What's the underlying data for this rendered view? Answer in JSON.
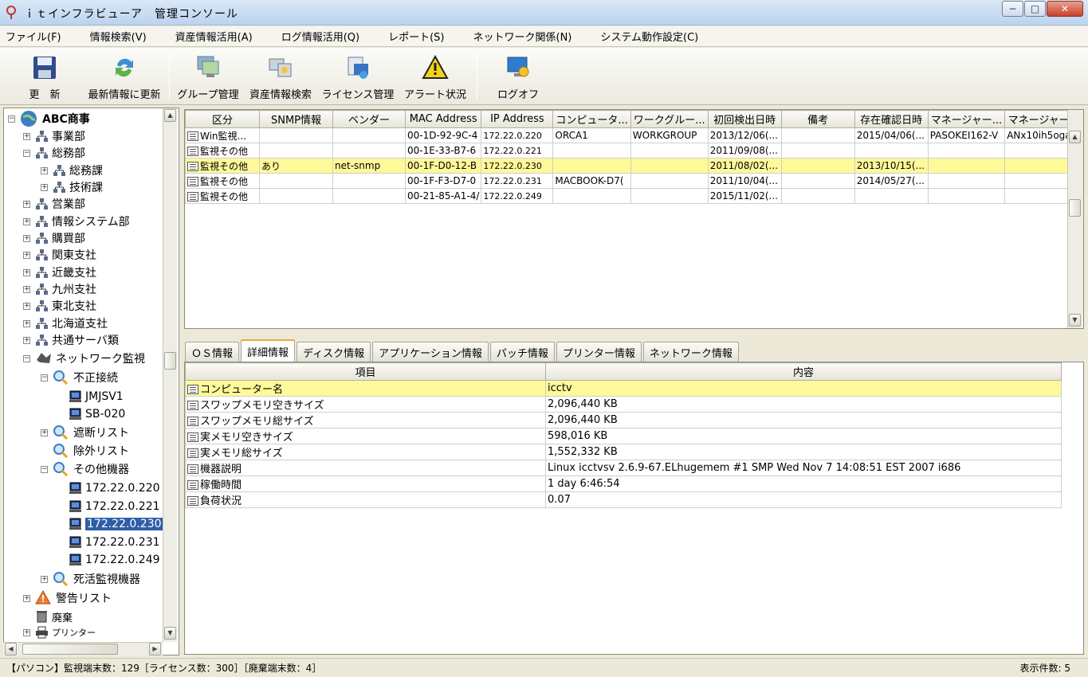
{
  "window": {
    "title": "ｉｔインフラビューア　管理コンソール",
    "min": "−",
    "max": "□",
    "close": "✕"
  },
  "menu": [
    "ファイル(F)",
    "情報検索(V)",
    "資産情報活用(A)",
    "ログ情報活用(Q)",
    "レポート(S)",
    "ネットワーク関係(N)",
    "システム動作設定(C)"
  ],
  "toolbar": {
    "update": "更　新",
    "refresh": "最新情報に更新",
    "group": "グループ管理",
    "asset_search": "資産情報検索",
    "license": "ライセンス管理",
    "alert": "アラート状況",
    "logoff": "ログオフ"
  },
  "tree": [
    {
      "label": "ABC商事",
      "exp": "−",
      "icon": "globe-icon",
      "bold": true
    },
    {
      "label": "事業部",
      "exp": "+",
      "icon": "org-icon"
    },
    {
      "label": "総務部",
      "exp": "−",
      "icon": "org-icon"
    },
    {
      "label": "総務課",
      "exp": "+",
      "icon": "org-icon"
    },
    {
      "label": "技術課",
      "exp": "+",
      "icon": "org-icon"
    },
    {
      "label": "営業部",
      "exp": "+",
      "icon": "org-icon"
    },
    {
      "label": "情報システム部",
      "exp": "+",
      "icon": "org-icon"
    },
    {
      "label": "購買部",
      "exp": "+",
      "icon": "org-icon"
    },
    {
      "label": "関東支社",
      "exp": "+",
      "icon": "org-icon"
    },
    {
      "label": "近畿支社",
      "exp": "+",
      "icon": "org-icon"
    },
    {
      "label": "九州支社",
      "exp": "+",
      "icon": "org-icon"
    },
    {
      "label": "東北支社",
      "exp": "+",
      "icon": "org-icon"
    },
    {
      "label": "北海道支社",
      "exp": "+",
      "icon": "org-icon"
    },
    {
      "label": "共通サーバ類",
      "exp": "+",
      "icon": "org-icon"
    },
    {
      "label": "ネットワーク監視",
      "exp": "−",
      "icon": "network-icon"
    },
    {
      "label": "不正接続",
      "exp": "−",
      "icon": "magnifier-icon"
    },
    {
      "label": "JMJSV1",
      "exp": "",
      "icon": "computer-icon"
    },
    {
      "label": "SB-020",
      "exp": "",
      "icon": "computer-icon"
    },
    {
      "label": "遮断リスト",
      "exp": "+",
      "icon": "magnifier-icon"
    },
    {
      "label": "除外リスト",
      "exp": "",
      "icon": "magnifier-icon"
    },
    {
      "label": "その他機器",
      "exp": "−",
      "icon": "magnifier-icon"
    },
    {
      "label": "172.22.0.220",
      "exp": "",
      "icon": "computer-icon"
    },
    {
      "label": "172.22.0.221",
      "exp": "",
      "icon": "computer-icon"
    },
    {
      "label": "172.22.0.230",
      "exp": "",
      "icon": "computer-icon",
      "selected": true
    },
    {
      "label": "172.22.0.231",
      "exp": "",
      "icon": "computer-icon"
    },
    {
      "label": "172.22.0.249",
      "exp": "",
      "icon": "computer-icon"
    },
    {
      "label": "死活監視機器",
      "exp": "+",
      "icon": "magnifier-icon"
    },
    {
      "label": "警告リスト",
      "exp": "+",
      "icon": "warning-icon"
    },
    {
      "label": "廃棄",
      "exp": "",
      "icon": "trash-icon"
    },
    {
      "label": "プリンター",
      "exp": "+",
      "icon": "printer-icon"
    }
  ],
  "device_table": {
    "columns": [
      "区分",
      "SNMP情報",
      "ベンダー",
      "MAC Address",
      "IP Address",
      "コンピュータ...",
      "ワークグルー...",
      "初回検出日時",
      "備考",
      "存在確認日時",
      "マネージャー...",
      "マネージャー..."
    ],
    "rows": [
      [
        "Win監視...",
        "",
        "",
        "00-1D-92-9C-4",
        "172.22.0.220",
        "ORCA1",
        "WORKGROUP",
        "2013/12/06(...",
        "",
        "2015/04/06(...",
        "PASOKEI162-V",
        "ANx10ih5ogaf9"
      ],
      [
        "監視その他",
        "",
        "",
        "00-1E-33-B7-6",
        "172.22.0.221",
        "",
        "",
        "2011/09/08(...",
        "",
        "",
        "",
        ""
      ],
      [
        "監視その他",
        "あり",
        "net-snmp",
        "00-1F-D0-12-B",
        "172.22.0.230",
        "",
        "",
        "2011/08/02(...",
        "",
        "2013/10/15(...",
        "",
        ""
      ],
      [
        "監視その他",
        "",
        "",
        "00-1F-F3-D7-0",
        "172.22.0.231",
        "MACBOOK-D7(",
        "",
        "2011/10/04(...",
        "",
        "2014/05/27(...",
        "",
        ""
      ],
      [
        "監視その他",
        "",
        "",
        "00-21-85-A1-4/",
        "172.22.0.249",
        "",
        "",
        "2015/11/02(...",
        "",
        "",
        "",
        ""
      ]
    ],
    "highlight_row": 2
  },
  "tabs": [
    "ＯＳ情報",
    "詳細情報",
    "ディスク情報",
    "アプリケーション情報",
    "パッチ情報",
    "プリンター情報",
    "ネットワーク情報"
  ],
  "active_tab": 1,
  "detail_table": {
    "columns": [
      "項目",
      "内容"
    ],
    "rows": [
      [
        "コンピューター名",
        "icctv"
      ],
      [
        "スワップメモリ空きサイズ",
        "2,096,440 KB"
      ],
      [
        "スワップメモリ総サイズ",
        "2,096,440 KB"
      ],
      [
        "実メモリ空きサイズ",
        "598,016 KB"
      ],
      [
        "実メモリ総サイズ",
        "1,552,332 KB"
      ],
      [
        "機器説明",
        "Linux icctvsv 2.6.9-67.ELhugemem #1 SMP Wed Nov 7 14:08:51 EST 2007 i686"
      ],
      [
        "稼働時間",
        "1 day  6:46:54"
      ],
      [
        "負荷状況",
        "0.07"
      ]
    ],
    "highlight_row": 0
  },
  "status": {
    "left": "【パソコン】監視端末数：129［ライセンス数：300］［廃棄端末数：4］",
    "right": "表示件数: 5"
  },
  "colors": {
    "highlight": "#fff99a",
    "selection": "#2f5ea8",
    "tab_accent": "#e9a93b"
  }
}
